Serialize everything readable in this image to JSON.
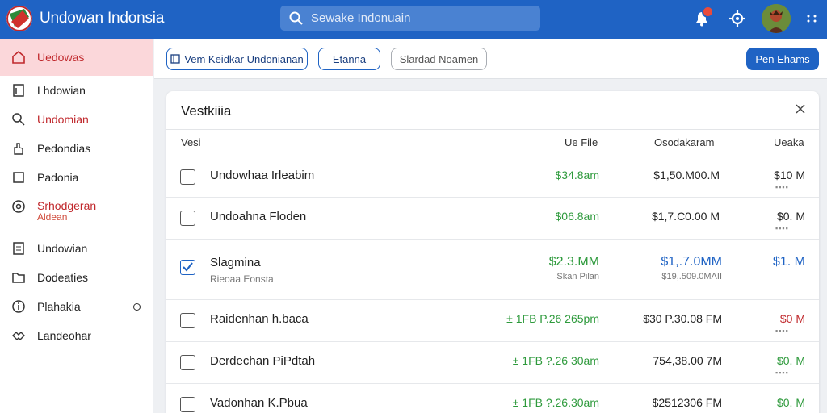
{
  "app": {
    "title": "Undowan Indonsia",
    "search_placeholder": "Sewake Indonuain",
    "notification_count": "",
    "colors": {
      "topbar": "#1f63c4",
      "accent_red": "#c0282c",
      "green": "#2e9a3c"
    }
  },
  "sidebar": {
    "items": [
      {
        "label": "Uedowas",
        "icon": "home-icon",
        "active": true
      },
      {
        "label": "Lhdowian",
        "icon": "document-icon"
      },
      {
        "label": "Undomian",
        "icon": "search-icon",
        "red": true
      },
      {
        "label": "Pedondias",
        "icon": "hand-icon"
      },
      {
        "label": "Padonia",
        "icon": "square-icon"
      },
      {
        "label": "Srhodgeran",
        "sub": "Aldean",
        "icon": "target-icon",
        "red": true
      },
      {
        "label": "Undowian",
        "icon": "list-icon"
      },
      {
        "label": "Dodeaties",
        "icon": "folder-icon"
      },
      {
        "label": "Plahakia",
        "icon": "info-icon"
      },
      {
        "label": "Landeohar",
        "icon": "handshake-icon"
      }
    ]
  },
  "toolbar": {
    "btn1": "Vem Keidkar Undonianan",
    "btn2": "Etanna",
    "btn3": "Slardad Noamen",
    "btn4": "Pen Ehams"
  },
  "panel": {
    "title": "Vestkiiia",
    "columns": [
      "Vesi",
      "Ue File",
      "Osodakaram",
      "Ueaka"
    ],
    "rows": [
      {
        "name": "Undowhaa Irleabim",
        "c1": "$34.8am",
        "c2": "$1,50.M00.M",
        "c3": "$10 M",
        "checked": false
      },
      {
        "name": "Undoahna Floden",
        "c1": "$06.8am",
        "c2": "$1,7.C0.00 M",
        "c3": "$0. M",
        "checked": false
      },
      {
        "name": "Slagmina",
        "sub": "Rieoaa Eonsta",
        "c1": "$2.3.MM",
        "c1_sub": "Skan Pilan",
        "c2": "$1,.7.0MM",
        "c2_sub": "$19,.509.0MAII",
        "c3": "$1. M",
        "checked": true
      },
      {
        "name": "Raidenhan h.baca",
        "c1": "± 1FB P.26 265pm",
        "c2": "$30 P.30.08 FM",
        "c3": "$0 M",
        "checked": false
      },
      {
        "name": "Derdechan PiPdtah",
        "c1": "± 1FB ?.26 30am",
        "c2": "754,38.00 7M",
        "c3": "$0. M",
        "checked": false
      },
      {
        "name": "Vadonhan K.Pbua",
        "c1": "± 1FB ?.26.30am",
        "c2": "$2512306 FM",
        "c3": "$0. M",
        "checked": false
      }
    ]
  }
}
